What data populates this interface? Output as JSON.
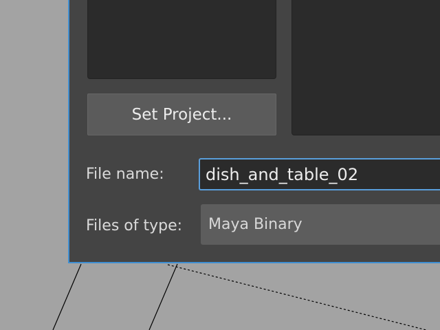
{
  "dialog": {
    "set_project_label": "Set Project...",
    "file_name_label": "File name:",
    "file_name_value": "dish_and_table_02",
    "files_of_type_label": "Files of type:",
    "files_of_type_value": "Maya Binary"
  },
  "colors": {
    "dialog_bg": "#444444",
    "focus_border": "#3f8fd2",
    "panel_bg": "#2b2b2b",
    "viewport_bg": "#a3a3a3"
  }
}
